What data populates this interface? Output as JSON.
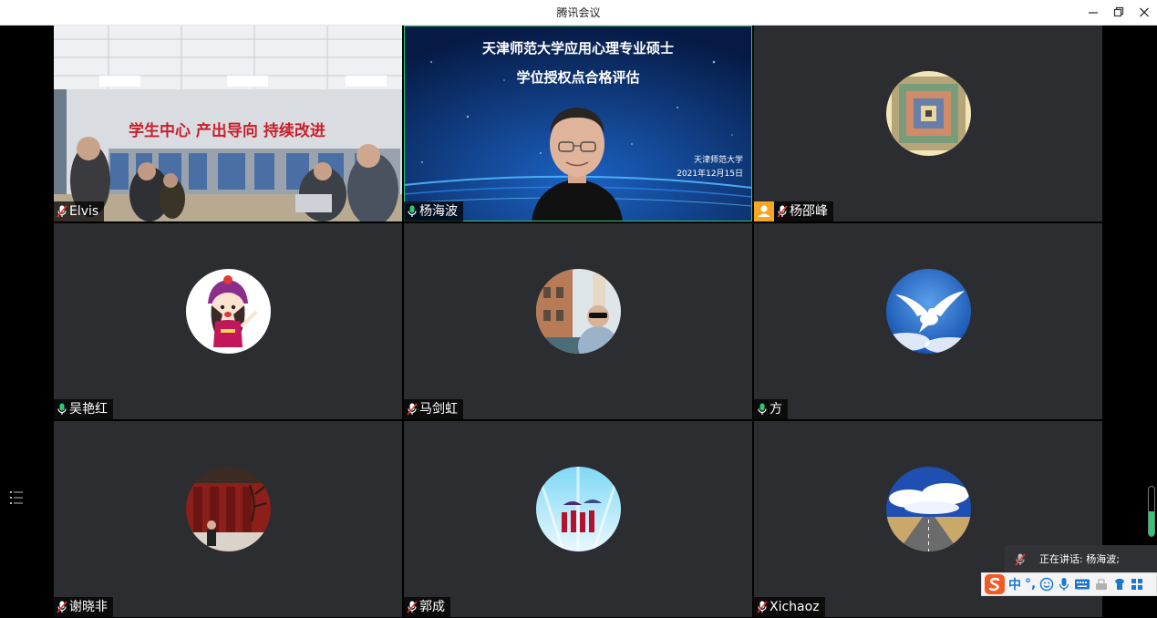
{
  "window": {
    "title": "腾讯会议"
  },
  "tiles": [
    {
      "name": "Elvis",
      "mic": "muted",
      "video": "classroom"
    },
    {
      "name": "杨海波",
      "mic": "active",
      "video": "speaker",
      "slide": {
        "title_line1": "天津师范大学应用心理专业硕士",
        "title_line2": "学位授权点合格评估",
        "org": "天津师范大学",
        "date": "2021年12月15日"
      }
    },
    {
      "name": "杨邵峰",
      "mic": "muted",
      "host": true,
      "avatar": "tunnel"
    },
    {
      "name": "吴艳红",
      "mic": "active",
      "avatar": "cartoon"
    },
    {
      "name": "马剑虹",
      "mic": "muted",
      "avatar": "photo"
    },
    {
      "name": "方",
      "mic": "active",
      "avatar": "dove"
    },
    {
      "name": "谢晓非",
      "mic": "muted",
      "avatar": "palace"
    },
    {
      "name": "郭成",
      "mic": "muted",
      "avatar": "umbrellas"
    },
    {
      "name": "Xichaoz",
      "mic": "muted",
      "avatar": "road"
    }
  ],
  "classroom_banner": "学生中心  产出导向  持续改进",
  "speaking": {
    "text": "正在讲话: 杨海波;"
  },
  "ime": {
    "lang": "中",
    "punct": "°,"
  },
  "volume_level": 0.5,
  "colors": {
    "accent_green": "#2ecc71",
    "tile_bg": "#2b2d30",
    "host_badge": "#f5a623",
    "slide_bg": "#0b2a66"
  }
}
